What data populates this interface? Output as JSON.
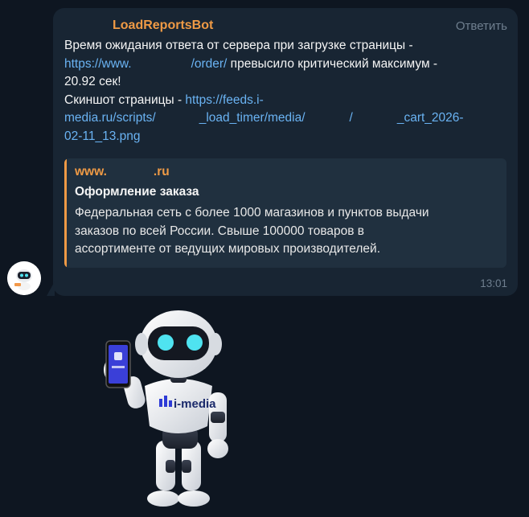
{
  "message": {
    "sender": "LoadReportsBot",
    "reply_label": "Ответить",
    "line1": "Время ожидания ответа от сервера при загрузке страницы -",
    "line2_link_a": "https://www.",
    "line2_link_b": "/order/",
    "line2_text": " превысило критический максимум -",
    "line3": "20.92 сек!",
    "line4_text": "Скиншот страницы - ",
    "line4_link": "https://feeds.i-",
    "line5_link_a": "media.ru/scripts/",
    "line5_link_b": "_load_timer/media/",
    "line5_link_c": "/",
    "line5_link_d": "_cart_2026-",
    "line6_link": "02-11_13.png",
    "time": "13:01"
  },
  "preview": {
    "site_a": "www.",
    "site_b": ".ru",
    "title": "Оформление заказа",
    "desc1": "Федеральная сеть с более 1000 магазинов и пунктов выдачи",
    "desc2": "заказов по всей России. Свыше 100000 товаров в",
    "desc3": "ассортименте от ведущих мировых производителей.",
    "accent": "#ef9a45"
  },
  "sticker": {
    "label": "i-media"
  },
  "colors": {
    "background": "#0e1621",
    "bubble": "#182533",
    "link": "#6ab3f3",
    "sender": "#ef9a45",
    "robot_eyes": "#4fe3f0"
  }
}
